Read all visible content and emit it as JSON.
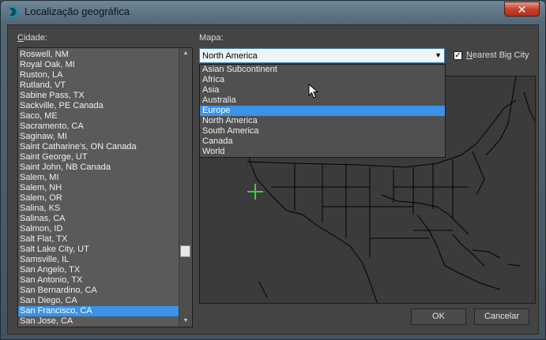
{
  "window": {
    "title": "Localização geográfica"
  },
  "labels": {
    "city_prefix": "C",
    "city_rest": "idade:",
    "map_label": "Mapa:",
    "nearest_prefix": "N",
    "nearest_rest": "earest Big City"
  },
  "cities": [
    "Roswell, NM",
    "Royal Oak, MI",
    "Ruston, LA",
    "Rutland, VT",
    "Sabine Pass, TX",
    "Sackville, PE Canada",
    "Saco, ME",
    "Sacramento, CA",
    "Saginaw, MI",
    "Saint Catharine's, ON Canada",
    "Saint George, UT",
    "Saint John, NB Canada",
    "Salem, MI",
    "Salem, NH",
    "Salem, OR",
    "Salina, KS",
    "Salinas, CA",
    "Salmon, ID",
    "Salt Flat, TX",
    "Salt Lake City, UT",
    "Samsville, IL",
    "San Angelo, TX",
    "San Antonio, TX",
    "San Bernardino, CA",
    "San Diego, CA",
    "San Francisco, CA",
    "San Jose, CA"
  ],
  "selected_city": "San Francisco, CA",
  "map_select": {
    "value": "North America"
  },
  "map_options": [
    "Asian Subcontinent",
    "Africa",
    "Asia",
    "Australia",
    "Europe",
    "North America",
    "South America",
    "Canada",
    "World"
  ],
  "hovered_option": "Europe",
  "nearest_big_city": {
    "checked": true,
    "mark": "✓"
  },
  "buttons": {
    "ok": "OK",
    "cancel": "Cancelar"
  },
  "icons": {
    "close": "✕",
    "dropdown": "▼",
    "scroll_up": "▲",
    "scroll_down": "▼"
  },
  "colors": {
    "selection": "#3a93e6",
    "marker": "#3ecf3e",
    "map_lines": "#000000"
  }
}
